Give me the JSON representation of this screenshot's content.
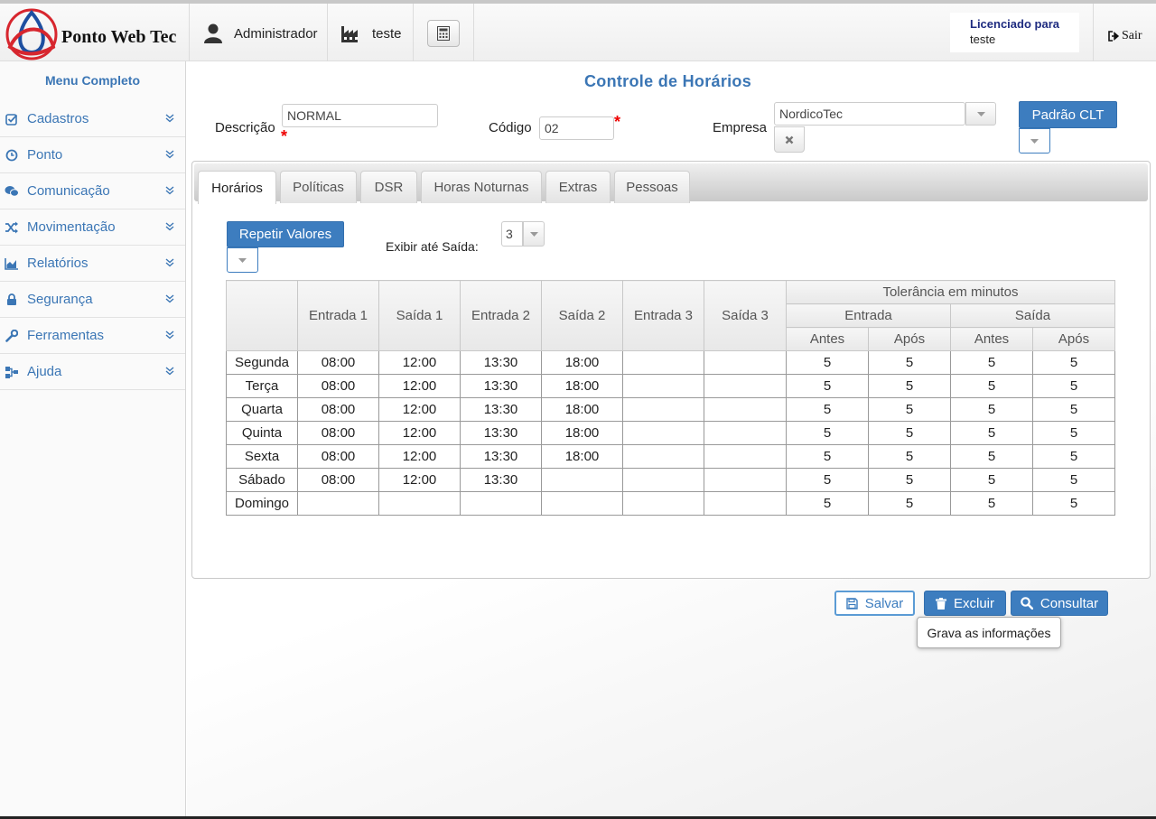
{
  "header": {
    "logo_text": "Ponto Web Tec",
    "user": "Administrador",
    "company": "teste",
    "license_label": "Licenciado para",
    "license_value": "teste",
    "logout": "Sair",
    "colors": {
      "logo_red": "#d7262e",
      "logo_blue": "#1d4fa0",
      "license": "#1f2c80"
    }
  },
  "sidebar": {
    "title": "Menu Completo",
    "items": [
      {
        "label": "Cadastros",
        "icon": "check-square-icon"
      },
      {
        "label": "Ponto",
        "icon": "clock-icon"
      },
      {
        "label": "Comunicação",
        "icon": "chat-icon"
      },
      {
        "label": "Movimentação",
        "icon": "shuffle-icon"
      },
      {
        "label": "Relatórios",
        "icon": "area-chart-icon"
      },
      {
        "label": "Segurança",
        "icon": "lock-icon"
      },
      {
        "label": "Ferramentas",
        "icon": "wrench-icon"
      },
      {
        "label": "Ajuda",
        "icon": "sitemap-icon"
      }
    ]
  },
  "form": {
    "title": "Controle de Horários",
    "descricao_label": "Descrição",
    "descricao_value": "NORMAL",
    "codigo_label": "Código",
    "codigo_value": "02",
    "empresa_label": "Empresa",
    "empresa_value": "NordicoTec",
    "padrao_button": "Padrão CLT",
    "required_mark": "*"
  },
  "tabs": [
    "Horários",
    "Políticas",
    "DSR",
    "Horas Noturnas",
    "Extras",
    "Pessoas"
  ],
  "active_tab": "Horários",
  "horarios": {
    "repeat_button": "Repetir Valores",
    "exibir_label": "Exibir até Saída:",
    "exibir_value": "3",
    "tolerance_header": "Tolerância em minutos",
    "columns": [
      "Entrada 1",
      "Saída 1",
      "Entrada 2",
      "Saída 2",
      "Entrada 3",
      "Saída 3"
    ],
    "tol_groups": [
      "Entrada",
      "Saída"
    ],
    "tol_sub": [
      "Antes",
      "Após",
      "Antes",
      "Após"
    ],
    "rows": [
      {
        "day": "Segunda",
        "times": [
          "08:00",
          "12:00",
          "13:30",
          "18:00",
          "",
          ""
        ],
        "tol": [
          "5",
          "5",
          "5",
          "5"
        ]
      },
      {
        "day": "Terça",
        "times": [
          "08:00",
          "12:00",
          "13:30",
          "18:00",
          "",
          ""
        ],
        "tol": [
          "5",
          "5",
          "5",
          "5"
        ]
      },
      {
        "day": "Quarta",
        "times": [
          "08:00",
          "12:00",
          "13:30",
          "18:00",
          "",
          ""
        ],
        "tol": [
          "5",
          "5",
          "5",
          "5"
        ]
      },
      {
        "day": "Quinta",
        "times": [
          "08:00",
          "12:00",
          "13:30",
          "18:00",
          "",
          ""
        ],
        "tol": [
          "5",
          "5",
          "5",
          "5"
        ]
      },
      {
        "day": "Sexta",
        "times": [
          "08:00",
          "12:00",
          "13:30",
          "18:00",
          "",
          ""
        ],
        "tol": [
          "5",
          "5",
          "5",
          "5"
        ]
      },
      {
        "day": "Sábado",
        "times": [
          "08:00",
          "12:00",
          "13:30",
          "",
          "",
          ""
        ],
        "tol": [
          "5",
          "5",
          "5",
          "5"
        ]
      },
      {
        "day": "Domingo",
        "times": [
          "",
          "",
          "",
          "",
          "",
          ""
        ],
        "tol": [
          "5",
          "5",
          "5",
          "5"
        ]
      }
    ]
  },
  "actions": {
    "save": "Salvar",
    "delete": "Excluir",
    "query": "Consultar",
    "tooltip": "Grava as informações"
  },
  "accent_color": "#3d7dbf"
}
